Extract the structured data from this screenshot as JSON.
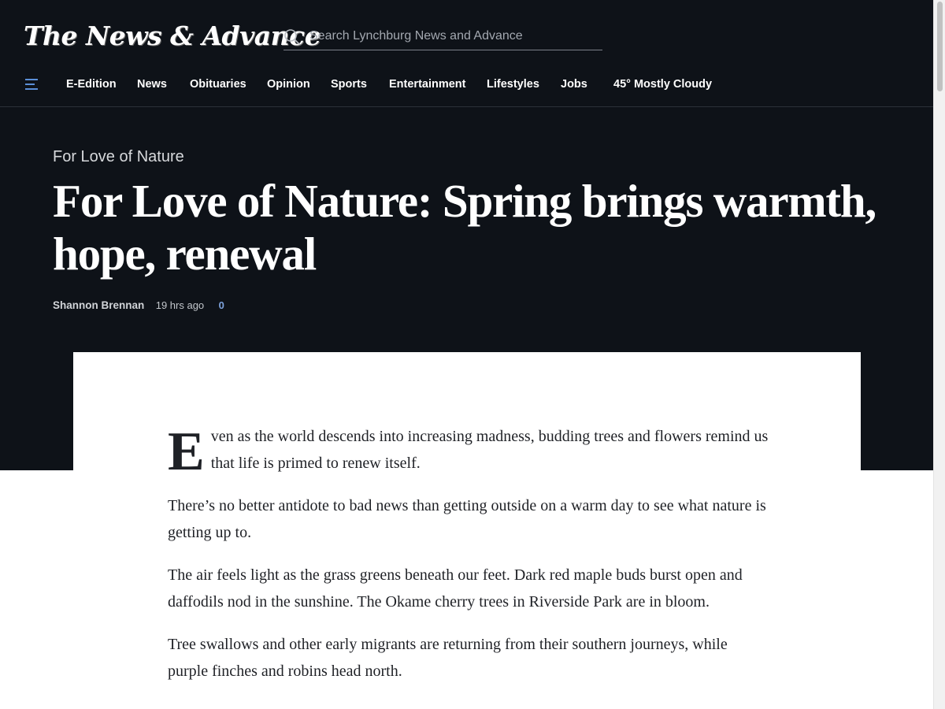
{
  "header": {
    "masthead": "The News & Advance",
    "search": {
      "placeholder": "Search Lynchburg News and Advance",
      "value": ""
    }
  },
  "nav": {
    "items": [
      "E-Edition",
      "News",
      "Obituaries",
      "Opinion",
      "Sports",
      "Entertainment",
      "Lifestyles",
      "Jobs"
    ],
    "weather": "45° Mostly Cloudy"
  },
  "article": {
    "kicker": "For Love of Nature",
    "headline": "For Love of Nature: Spring brings warmth, hope, renewal",
    "author": "Shannon Brennan",
    "timestamp": "19 hrs ago",
    "comment_count": "0",
    "drop_cap": "E",
    "first_paragraph_rest": "ven as the world descends into increasing madness, budding trees and flowers remind us that life is primed to renew itself.",
    "paragraphs": [
      "There’s no better antidote to bad news than getting outside on a warm day to see what nature is getting up to.",
      "The air feels light as the grass greens beneath our feet. Dark red maple buds burst open and daffodils nod in the sunshine. The Okame cherry trees in Riverside Park are in bloom.",
      "Tree swallows and other early migrants are returning from their southern journeys, while purple finches and robins head north."
    ]
  },
  "colors": {
    "header_bg": "#0e1218",
    "accent_link": "#7ea3dd",
    "menu_icon": "#5b8fd8"
  },
  "icons": {
    "menu": "hamburger-menu-icon",
    "search": "search-icon"
  }
}
